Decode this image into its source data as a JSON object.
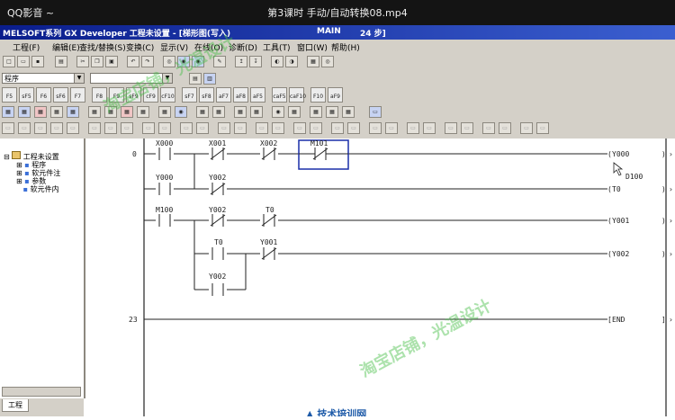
{
  "player": {
    "left": "QQ影音 ~",
    "title": "第3课时 手动/自动转换08.mp4"
  },
  "window": {
    "title": "MELSOFT系列 GX Developer 工程未设置 - [梯形图(写入)",
    "mode": "MAIN",
    "steps": "24 步]"
  },
  "menu": [
    "工程(F)",
    "编辑(E)",
    "查找/替换(S)",
    "变换(C)",
    "显示(V)",
    "在线(O)",
    "诊断(D)",
    "工具(T)",
    "窗口(W)",
    "帮助(H)"
  ],
  "toolbar": {
    "program_combo": "程序",
    "fkeys": [
      "F5",
      "sF5",
      "F6",
      "sF6",
      "F7",
      "F8",
      "F9",
      "sF9",
      "cF9",
      "cF10",
      "sF7",
      "sF8",
      "aF7",
      "aF8",
      "aF5",
      "caF5",
      "caF10",
      "F10",
      "aF9"
    ]
  },
  "project": {
    "root": "工程未设置",
    "items": [
      "程序",
      "软元件注",
      "参数",
      "软元件内"
    ],
    "tab": "工程"
  },
  "ladder": {
    "step_labels": [
      "0",
      "23"
    ],
    "rung1": {
      "contacts": [
        "X000",
        "X001",
        "X002",
        "M101"
      ],
      "coil": "Y000"
    },
    "rung2": {
      "contacts": [
        "Y000",
        "Y002"
      ],
      "coil": "T0",
      "constant": "D100"
    },
    "rung3": {
      "contacts": [
        "M100",
        "Y002",
        "T0"
      ],
      "coil": "Y001"
    },
    "rung4": {
      "contacts": [
        "T0",
        "Y001"
      ],
      "coil": "Y002"
    },
    "rung5": {
      "contacts": [
        "Y002"
      ]
    },
    "end": "END"
  },
  "watermark": {
    "line1": "淘宝店铺，光温设计",
    "line2": "淘宝店铺，光温设计"
  },
  "bottom": "技术培训网"
}
